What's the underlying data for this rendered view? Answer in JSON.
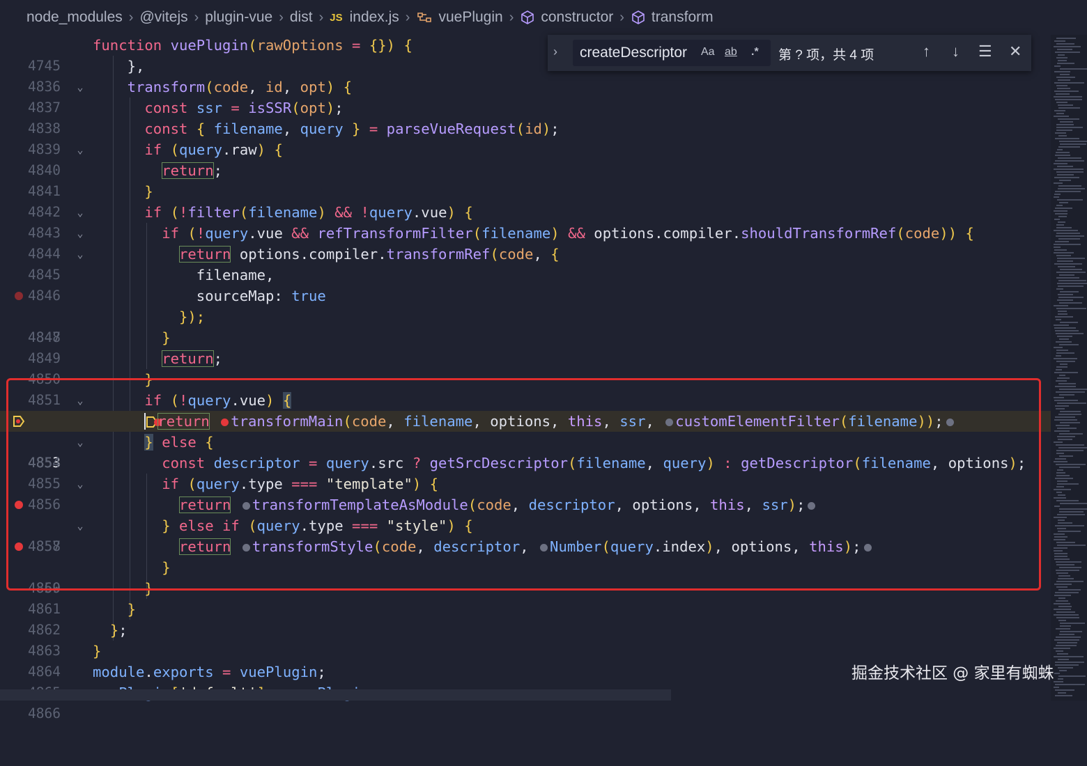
{
  "breadcrumb": {
    "items": [
      "node_modules",
      "@vitejs",
      "plugin-vue",
      "dist",
      "index.js",
      "vuePlugin",
      "constructor",
      "transform"
    ],
    "file_badge": "JS"
  },
  "find_widget": {
    "search_value": "createDescriptor",
    "match_case": "Aa",
    "whole_word": "ab",
    "regex": ".*",
    "result_count": "第 ? 项，共 4 项"
  },
  "editor": {
    "current_line": "4853",
    "line_numbers": [
      "4745",
      "4836",
      "4837",
      "4838",
      "4839",
      "4840",
      "4841",
      "4842",
      "4843",
      "4844",
      "4845",
      "4846",
      "4847",
      "4848",
      "4849",
      "4850",
      "4851",
      "4852",
      "4853",
      "4854",
      "4855",
      "4856",
      "4857",
      "4858",
      "4859",
      "4860",
      "4861",
      "4862",
      "4863",
      "4864",
      "4865",
      "4866"
    ]
  },
  "code": {
    "l4745": [
      "function",
      "vuePlugin",
      "rawOptions",
      "= {}) {"
    ],
    "l4836": "},",
    "l4837": [
      "transform",
      "code",
      "id",
      "opt"
    ],
    "l4838": [
      "const",
      "ssr",
      "isSSR",
      "opt"
    ],
    "l4839": [
      "const",
      "filename",
      "query",
      "parseVueRequest",
      "id"
    ],
    "l4840": [
      "if",
      "query",
      "raw"
    ],
    "l4841": "return",
    "l4843": [
      "if",
      "filter",
      "filename",
      "query",
      "vue"
    ],
    "l4844": [
      "if",
      "query",
      "vue",
      "refTransformFilter",
      "filename",
      "options",
      "compiler",
      "shouldTransformRef",
      "code"
    ],
    "l4845": [
      "return",
      "options",
      "compiler",
      "transformRef",
      "code"
    ],
    "l4846": "filename,",
    "l4847": [
      "sourceMap",
      "true"
    ],
    "l4848": "});",
    "l4850": "return",
    "l4852": [
      "if",
      "query",
      "vue"
    ],
    "l4853": [
      "return",
      "transformMain",
      "code",
      "filename",
      "options",
      "this",
      "ssr",
      "customElementFilter",
      "filename"
    ],
    "l4854": [
      "else"
    ],
    "l4855": [
      "const",
      "descriptor",
      "query",
      "src",
      "getSrcDescriptor",
      "filename",
      "query",
      "getDescriptor",
      "filename",
      "options"
    ],
    "l4856": [
      "if",
      "query",
      "type",
      "\"template\""
    ],
    "l4857": [
      "return",
      "transformTemplateAsModule",
      "code",
      "descriptor",
      "options",
      "this",
      "ssr"
    ],
    "l4858": [
      "else if",
      "query",
      "type",
      "\"style\""
    ],
    "l4859": [
      "return",
      "transformStyle",
      "code",
      "descriptor",
      "Number",
      "query",
      "index",
      "options",
      "this"
    ],
    "l4865": [
      "module",
      "exports",
      "vuePlugin"
    ],
    "l4866": [
      "vuePlugin",
      "'default'",
      "vuePlugin"
    ]
  },
  "watermark": "掘金技术社区 @ 家里有蜘蛛",
  "colors": {
    "background": "#1f2230",
    "keyword": "#f2688c",
    "function": "#b79cff",
    "param": "#e6a56b",
    "variable": "#7fb2ff",
    "bracket": "#f0c94d",
    "breakpoint": "#e5383b",
    "highlight_box": "#e02d2d"
  },
  "icons": [
    "chevron-right-icon",
    "js-file-icon",
    "symbol-method-icon",
    "symbol-class-icon",
    "breakpoint-icon",
    "current-execution-icon",
    "arrow-up-icon",
    "arrow-down-icon",
    "selection-icon",
    "close-icon",
    "chevron-down-icon"
  ]
}
